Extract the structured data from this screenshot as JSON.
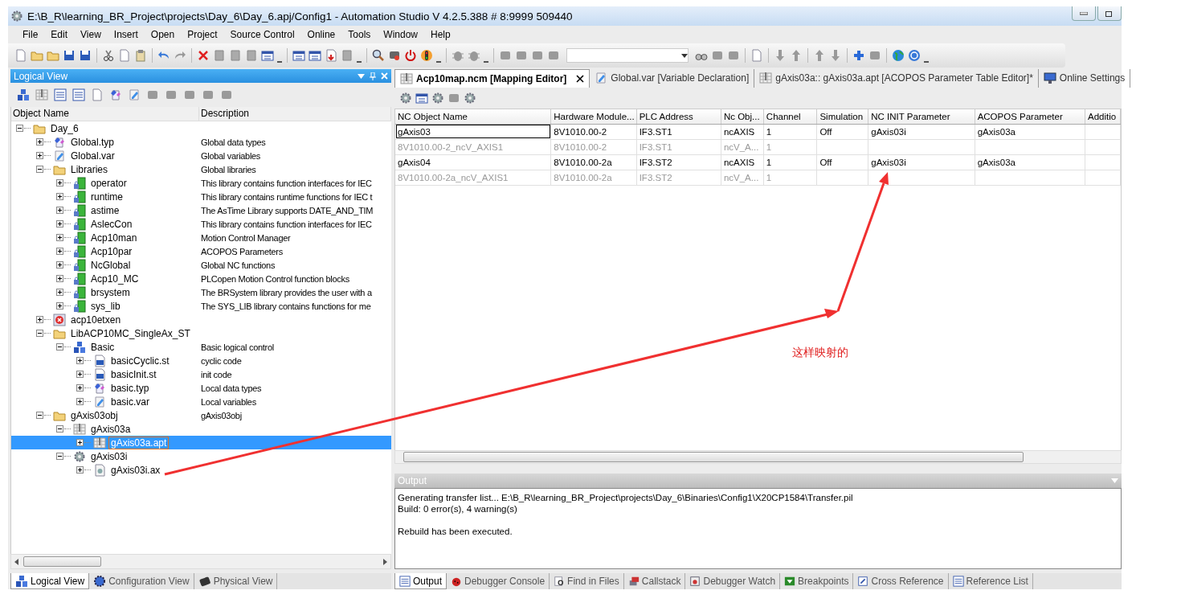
{
  "window": {
    "title": "E:\\B_R\\learning_BR_Project\\projects\\Day_6\\Day_6.apj/Config1 - Automation Studio V 4.2.5.388 # 8:9999 509440"
  },
  "menu": [
    "File",
    "Edit",
    "View",
    "Insert",
    "Open",
    "Project",
    "Source Control",
    "Online",
    "Tools",
    "Window",
    "Help"
  ],
  "logical_view": {
    "title": "Logical View",
    "columns": [
      "Object Name",
      "Description"
    ],
    "tree": [
      {
        "name": "Day_6",
        "kind": "folder",
        "expanded": true,
        "selected": false,
        "children": [
          {
            "name": "Global.typ",
            "description": "Global data types",
            "kind": "typ",
            "expanded": false,
            "selected": false
          },
          {
            "name": "Global.var",
            "description": "Global variables",
            "kind": "var",
            "expanded": false,
            "selected": false
          },
          {
            "name": "Libraries",
            "description": "Global libraries",
            "kind": "folder",
            "expanded": true,
            "selected": false,
            "children": [
              {
                "name": "operator",
                "description": "This library contains function interfaces for IEC",
                "kind": "library",
                "expanded": false,
                "selected": false
              },
              {
                "name": "runtime",
                "description": "This library contains runtime functions for IEC t",
                "kind": "library",
                "expanded": false,
                "selected": false
              },
              {
                "name": "astime",
                "description": "The AsTime Library supports DATE_AND_TIM",
                "kind": "library",
                "expanded": false,
                "selected": false
              },
              {
                "name": "AslecCon",
                "description": "This library contains function interfaces for IEC",
                "kind": "library",
                "expanded": false,
                "selected": false
              },
              {
                "name": "Acp10man",
                "description": "Motion Control Manager",
                "kind": "library",
                "expanded": false,
                "selected": false
              },
              {
                "name": "Acp10par",
                "description": "ACOPOS Parameters",
                "kind": "library",
                "expanded": false,
                "selected": false
              },
              {
                "name": "NcGlobal",
                "description": "Global NC functions",
                "kind": "library",
                "expanded": false,
                "selected": false
              },
              {
                "name": "Acp10_MC",
                "description": "PLCopen Motion Control function blocks",
                "kind": "library",
                "expanded": false,
                "selected": false
              },
              {
                "name": "brsystem",
                "description": "The BRSystem library provides the user with a",
                "kind": "library",
                "expanded": false,
                "selected": false
              },
              {
                "name": "sys_lib",
                "description": "The SYS_LIB library contains functions for me",
                "kind": "library",
                "expanded": false,
                "selected": false
              }
            ]
          },
          {
            "name": "acp10etxen",
            "kind": "error",
            "expanded": false,
            "selected": false
          },
          {
            "name": "LibACP10MC_SingleAx_ST",
            "kind": "folder",
            "expanded": true,
            "selected": false,
            "children": [
              {
                "name": "Basic",
                "description": "Basic logical control",
                "kind": "package",
                "expanded": true,
                "selected": false,
                "children": [
                  {
                    "name": "basicCyclic.st",
                    "description": "cyclic code",
                    "kind": "st",
                    "expanded": false,
                    "selected": false
                  },
                  {
                    "name": "basicInit.st",
                    "description": "init code",
                    "kind": "st",
                    "expanded": false,
                    "selected": false
                  },
                  {
                    "name": "basic.typ",
                    "description": "Local data types",
                    "kind": "typ",
                    "expanded": false,
                    "selected": false
                  },
                  {
                    "name": "basic.var",
                    "description": "Local variables",
                    "kind": "var",
                    "expanded": false,
                    "selected": false
                  }
                ]
              }
            ]
          },
          {
            "name": "gAxis03obj",
            "description": "gAxis03obj",
            "kind": "folder",
            "expanded": true,
            "selected": false,
            "children": [
              {
                "name": "gAxis03a",
                "kind": "table",
                "expanded": true,
                "selected": false,
                "children": [
                  {
                    "name": "gAxis03a.apt",
                    "kind": "table",
                    "expanded": false,
                    "selected": true
                  }
                ]
              },
              {
                "name": "gAxis03i",
                "kind": "gear",
                "expanded": true,
                "selected": false,
                "children": [
                  {
                    "name": "gAxis03i.ax",
                    "kind": "axfile",
                    "expanded": false,
                    "selected": false
                  }
                ]
              }
            ]
          }
        ]
      }
    ],
    "tabs": [
      {
        "label": "Logical View",
        "selected": true
      },
      {
        "label": "Configuration View",
        "selected": false
      },
      {
        "label": "Physical View",
        "selected": false
      }
    ]
  },
  "editor": {
    "tabs": [
      {
        "label": "Acp10map.ncm [Mapping Editor]",
        "selected": true
      },
      {
        "label": "Global.var [Variable Declaration]",
        "selected": false
      },
      {
        "label": "gAxis03a:: gAxis03a.apt [ACOPOS Parameter Table Editor]*",
        "selected": false
      },
      {
        "label": "Online Settings",
        "selected": false
      }
    ],
    "table": {
      "columns": [
        "NC Object Name",
        "Hardware Module...",
        "PLC Address",
        "Nc Obj...",
        "Channel",
        "Simulation",
        "NC INIT Parameter",
        "ACOPOS Parameter",
        "Additio"
      ],
      "rows": [
        {
          "cells": [
            "gAxis03",
            "8V1010.00-2",
            "IF3.ST1",
            "ncAXIS",
            "1",
            "Off",
            "gAxis03i",
            "gAxis03a"
          ],
          "disabled": false,
          "focused": true
        },
        {
          "cells": [
            "8V1010.00-2_ncV_AXIS1",
            "8V1010.00-2",
            "IF3.ST1",
            "ncV_A...",
            "1"
          ],
          "disabled": true,
          "focused": false
        },
        {
          "cells": [
            "gAxis04",
            "8V1010.00-2a",
            "IF3.ST2",
            "ncAXIS",
            "1",
            "Off",
            "gAxis03i",
            "gAxis03a"
          ],
          "disabled": false,
          "focused": false
        },
        {
          "cells": [
            "8V1010.00-2a_ncV_AXIS1",
            "8V1010.00-2a",
            "IF3.ST2",
            "ncV_A...",
            "1"
          ],
          "disabled": true,
          "focused": false
        }
      ]
    }
  },
  "output": {
    "title": "Output",
    "blocks": [
      [
        "Generating transfer list... E:\\B_R\\learning_BR_Project\\projects\\Day_6\\Binaries\\Config1\\X20CP1584\\Transfer.pil",
        "Build: 0 error(s), 4 warning(s)"
      ],
      [
        "Rebuild has been executed."
      ]
    ],
    "tabs": [
      {
        "label": "Output",
        "selected": true
      },
      {
        "label": "Debugger Console",
        "selected": false
      },
      {
        "label": "Find in Files",
        "selected": false
      },
      {
        "label": "Callstack",
        "selected": false
      },
      {
        "label": "Debugger Watch",
        "selected": false
      },
      {
        "label": "Breakpoints",
        "selected": false
      },
      {
        "label": "Cross Reference",
        "selected": false
      },
      {
        "label": "Reference List",
        "selected": false
      }
    ]
  },
  "annotation": {
    "text": "这样映射的"
  }
}
